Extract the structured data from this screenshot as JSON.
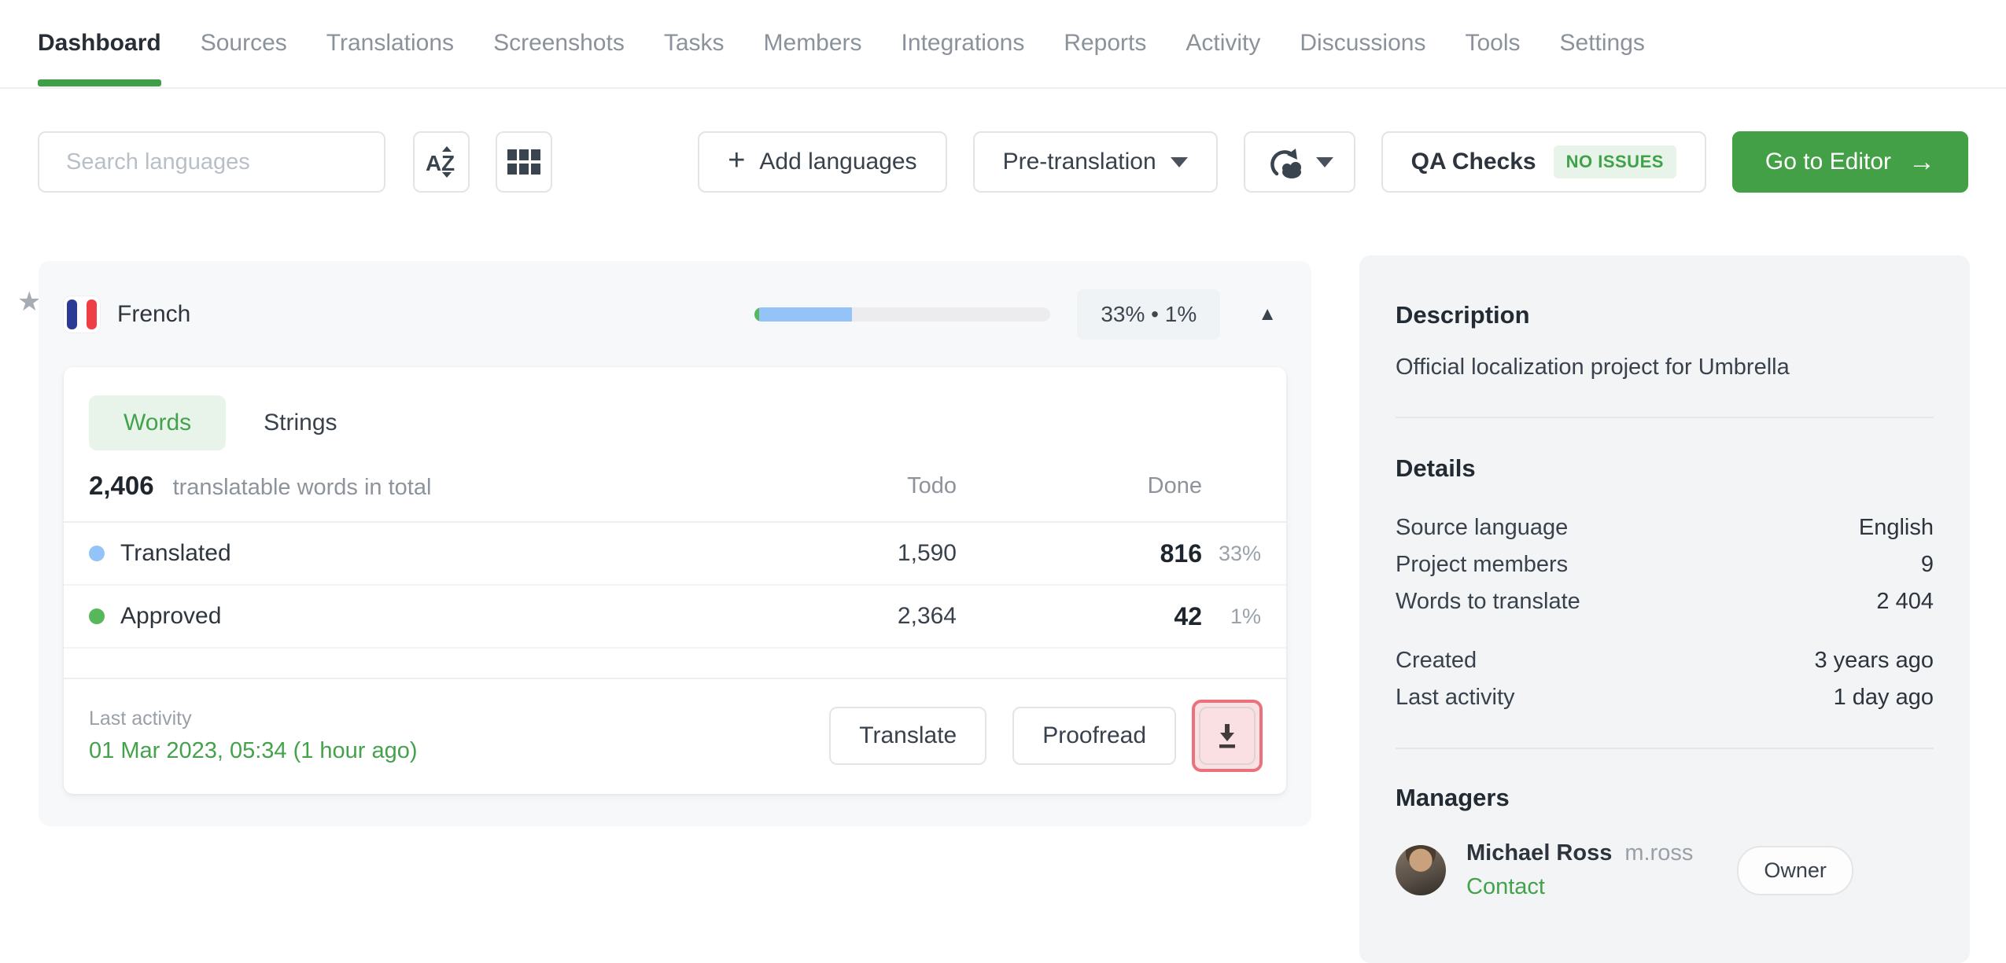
{
  "nav": {
    "items": [
      {
        "label": "Dashboard"
      },
      {
        "label": "Sources"
      },
      {
        "label": "Translations"
      },
      {
        "label": "Screenshots"
      },
      {
        "label": "Tasks"
      },
      {
        "label": "Members"
      },
      {
        "label": "Integrations"
      },
      {
        "label": "Reports"
      },
      {
        "label": "Activity"
      },
      {
        "label": "Discussions"
      },
      {
        "label": "Tools"
      },
      {
        "label": "Settings"
      }
    ]
  },
  "toolbar": {
    "search_placeholder": "Search languages",
    "add_languages_label": "Add languages",
    "pre_translation_label": "Pre-translation",
    "qa_checks_label": "QA Checks",
    "qa_status": "NO ISSUES",
    "go_to_editor_label": "Go to Editor",
    "go_to_editor_arrow": "→",
    "plus_glyph": "+"
  },
  "language_card": {
    "language": "French",
    "favorite_star": "★",
    "collapse_arrow": "▲",
    "progress_badge": "33% • 1%",
    "progress": {
      "approved_bar_pct": 1.5,
      "translated_bar_pct": 31.5
    },
    "tabs": {
      "words": "Words",
      "strings": "Strings"
    },
    "total": {
      "value": "2,406",
      "label": "translatable words in total"
    },
    "columns": {
      "todo": "Todo",
      "done": "Done"
    },
    "rows": [
      {
        "label": "Translated",
        "todo": "1,590",
        "done": "816",
        "percent": "33%"
      },
      {
        "label": "Approved",
        "todo": "2,364",
        "done": "42",
        "percent": "1%"
      }
    ],
    "footer": {
      "last_activity_label": "Last activity",
      "last_activity_value": "01 Mar 2023, 05:34 (1 hour ago)",
      "translate_label": "Translate",
      "proofread_label": "Proofread"
    }
  },
  "sidebar": {
    "description": {
      "title": "Description",
      "text": "Official localization project for Umbrella"
    },
    "details": {
      "title": "Details",
      "rows": [
        [
          "Source language",
          "English"
        ],
        [
          "Project members",
          "9"
        ],
        [
          "Words to translate",
          "2 404"
        ]
      ],
      "rows2": [
        [
          "Created",
          "3 years ago"
        ],
        [
          "Last activity",
          "1 day ago"
        ]
      ]
    },
    "managers": {
      "title": "Managers",
      "name": "Michael Ross",
      "username": "m.ross",
      "contact_label": "Contact",
      "role_badge": "Owner"
    }
  },
  "colors": {
    "accent_green": "#43a047",
    "translated_blue": "#94c3f8",
    "approved_green": "#57b75b",
    "annotation_red": "#ea727c",
    "nav_underline_green": "#3f9e48"
  }
}
